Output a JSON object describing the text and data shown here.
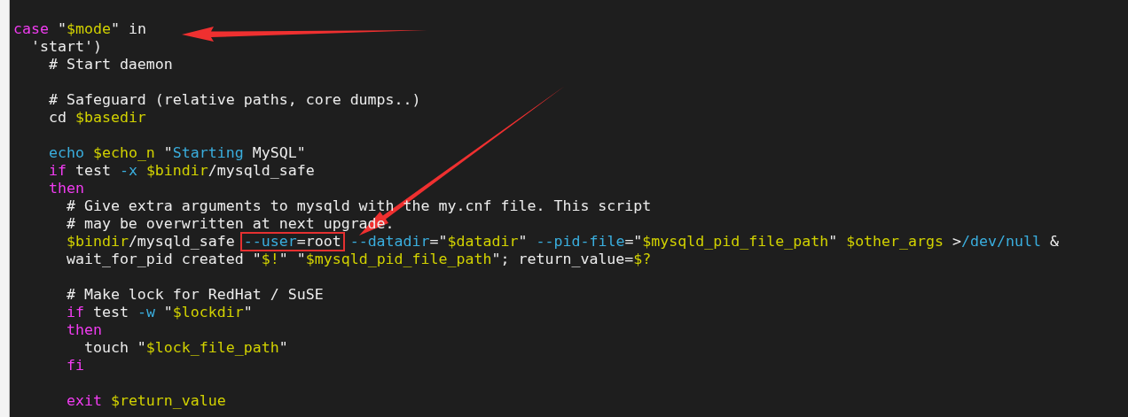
{
  "editor": {
    "lines": [
      {
        "kind": "code",
        "tokens": [
          {
            "t": "case",
            "kind": "keyword"
          },
          {
            "t": " \"",
            "kind": "plain"
          },
          {
            "t": "$mode",
            "kind": "variable"
          },
          {
            "t": "\" in",
            "kind": "plain"
          }
        ]
      },
      {
        "kind": "code",
        "tokens": [
          {
            "t": "  'start')",
            "kind": "plain"
          }
        ]
      },
      {
        "kind": "code",
        "tokens": [
          {
            "t": "    # Start daemon",
            "kind": "plain"
          }
        ]
      },
      {
        "kind": "blank"
      },
      {
        "kind": "code",
        "tokens": [
          {
            "t": "    # Safeguard (relative paths, core dumps..)",
            "kind": "plain"
          }
        ]
      },
      {
        "kind": "code",
        "tokens": [
          {
            "t": "    cd ",
            "kind": "plain"
          },
          {
            "t": "$basedir",
            "kind": "variable"
          }
        ]
      },
      {
        "kind": "blank"
      },
      {
        "kind": "code",
        "tokens": [
          {
            "t": "    echo",
            "kind": "option"
          },
          {
            "t": " $echo_n",
            "kind": "variable"
          },
          {
            "t": " \"",
            "kind": "plain"
          },
          {
            "t": "Starting",
            "kind": "option"
          },
          {
            "t": " MySQL\"",
            "kind": "plain"
          }
        ]
      },
      {
        "kind": "code",
        "tokens": [
          {
            "t": "    if",
            "kind": "keyword"
          },
          {
            "t": " test ",
            "kind": "plain"
          },
          {
            "t": "-x",
            "kind": "option"
          },
          {
            "t": " $bindir",
            "kind": "variable"
          },
          {
            "t": "/mysqld_safe",
            "kind": "plain"
          }
        ]
      },
      {
        "kind": "code",
        "tokens": [
          {
            "t": "    then",
            "kind": "keyword"
          }
        ]
      },
      {
        "kind": "code",
        "tokens": [
          {
            "t": "      # Give extra arguments to mysqld with the my.cnf file. This script",
            "kind": "plain"
          }
        ]
      },
      {
        "kind": "code",
        "tokens": [
          {
            "t": "      # may be overwritten at next upgrade.",
            "kind": "plain"
          }
        ]
      },
      {
        "kind": "code",
        "tokens": [
          {
            "t": "      $bindir",
            "kind": "variable"
          },
          {
            "t": "/mysqld_safe ",
            "kind": "plain"
          },
          {
            "t": "--user",
            "kind": "option",
            "boxed": true
          },
          {
            "t": "=root",
            "kind": "plain",
            "boxed": true
          },
          {
            "t": " --datadir",
            "kind": "option"
          },
          {
            "t": "=\"",
            "kind": "plain"
          },
          {
            "t": "$datadir",
            "kind": "variable"
          },
          {
            "t": "\" ",
            "kind": "plain"
          },
          {
            "t": "--pid-file",
            "kind": "option"
          },
          {
            "t": "=\"",
            "kind": "plain"
          },
          {
            "t": "$mysqld_pid_file_path",
            "kind": "variable"
          },
          {
            "t": "\" ",
            "kind": "plain"
          },
          {
            "t": "$other_args",
            "kind": "variable"
          },
          {
            "t": " >",
            "kind": "plain"
          },
          {
            "t": "/dev/null",
            "kind": "option"
          },
          {
            "t": " &",
            "kind": "plain"
          }
        ]
      },
      {
        "kind": "code",
        "tokens": [
          {
            "t": "      wait_for_pid created \"",
            "kind": "plain"
          },
          {
            "t": "$!",
            "kind": "variable"
          },
          {
            "t": "\" \"",
            "kind": "plain"
          },
          {
            "t": "$mysqld_pid_file_path",
            "kind": "variable"
          },
          {
            "t": "\"; return_value=",
            "kind": "plain"
          },
          {
            "t": "$?",
            "kind": "variable"
          }
        ]
      },
      {
        "kind": "blank"
      },
      {
        "kind": "code",
        "tokens": [
          {
            "t": "      # Make lock for RedHat / SuSE",
            "kind": "plain"
          }
        ]
      },
      {
        "kind": "code",
        "tokens": [
          {
            "t": "      if",
            "kind": "keyword"
          },
          {
            "t": " test ",
            "kind": "plain"
          },
          {
            "t": "-w",
            "kind": "option"
          },
          {
            "t": " \"",
            "kind": "plain"
          },
          {
            "t": "$lockdir",
            "kind": "variable"
          },
          {
            "t": "\"",
            "kind": "plain"
          }
        ]
      },
      {
        "kind": "code",
        "tokens": [
          {
            "t": "      then",
            "kind": "keyword"
          }
        ]
      },
      {
        "kind": "code",
        "tokens": [
          {
            "t": "        touch \"",
            "kind": "plain"
          },
          {
            "t": "$lock_file_path",
            "kind": "variable"
          },
          {
            "t": "\"",
            "kind": "plain"
          }
        ]
      },
      {
        "kind": "code",
        "tokens": [
          {
            "t": "      fi",
            "kind": "keyword"
          }
        ]
      },
      {
        "kind": "blank"
      },
      {
        "kind": "code",
        "tokens": [
          {
            "t": "      exit",
            "kind": "keyword"
          },
          {
            "t": " $return_value",
            "kind": "variable"
          }
        ]
      }
    ]
  }
}
